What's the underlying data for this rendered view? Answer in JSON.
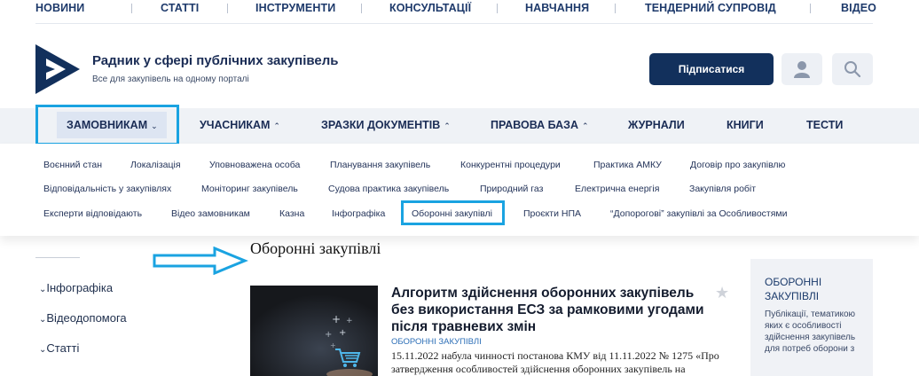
{
  "top_nav": [
    "НОВИНИ",
    "СТАТТІ",
    "ІНСТРУМЕНТИ",
    "КОНСУЛЬТАЦІЇ",
    "НАВЧАННЯ",
    "ТЕНДЕРНИЙ СУПРОВІД",
    "ВІДЕО"
  ],
  "header": {
    "title": "Радник у сфері публічних закупівель",
    "subtitle": "Все для закупівель на одному порталі",
    "subscribe_label": "Підписатися",
    "user_icon": "user-icon",
    "search_icon": "search-icon"
  },
  "main_nav": [
    {
      "label": "ЗАМОВНИКАМ",
      "chevron": "⌄"
    },
    {
      "label": "УЧАСНИКАМ",
      "chevron": "⌃"
    },
    {
      "label": "ЗРАЗКИ ДОКУМЕНТІВ",
      "chevron": "⌃"
    },
    {
      "label": "ПРАВОВА БАЗА",
      "chevron": "⌃"
    },
    {
      "label": "ЖУРНАЛИ"
    },
    {
      "label": "КНИГИ"
    },
    {
      "label": "ТЕСТИ"
    }
  ],
  "submenu": {
    "row1": [
      "Воєнний стан",
      "Локалізація",
      "Уповноважена особа",
      "Планування закупівель",
      "Конкурентні процедури",
      "Практика АМКУ",
      "Договір про закупівлю"
    ],
    "row2": [
      "Відповідальність у закупівлях",
      "Моніторинг закупівель",
      "Судова практика закупівель",
      "Природний газ",
      "Електрична енергія",
      "Закупівля робіт"
    ],
    "row3": [
      "Експерти відповідають",
      "Відео замовникам",
      "Казна",
      "Інфографіка",
      "Оборонні закупівлі",
      "Проєкти НПА",
      "“Допорогові” закупівлі за Особливостями"
    ]
  },
  "left_sidebar": [
    "Інфографіка",
    "Відеодопомога",
    "Статті"
  ],
  "page_title": "Оборонні закупівлі",
  "article": {
    "title": "Алгоритм здійснення оборонних закупівель без використання ЕСЗ за рамковими угодами після травневих змін",
    "category": "ОБОРОННІ ЗАКУПІВЛІ",
    "excerpt": "15.11.2022 набула чинності постанова КМУ від 11.11.2022 № 1275 «Про затвердження особливостей здійснення оборонних закупівель на"
  },
  "right_box": {
    "title": "ОБОРОННІ ЗАКУПІВЛІ",
    "text": "Публікації, тематикою яких є особливості здійснення закупівель для потреб оборони з"
  },
  "colors": {
    "brand_dark": "#12305c",
    "highlight": "#1aa3e1",
    "nav_bg": "#eff2f6"
  }
}
